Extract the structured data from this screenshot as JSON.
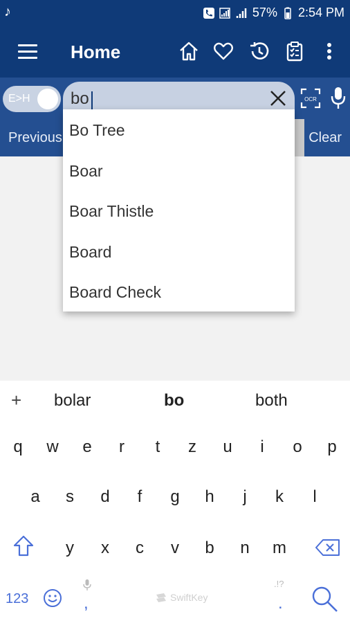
{
  "status_bar": {
    "battery": "57%",
    "time": "2:54 PM"
  },
  "app_bar": {
    "title": "Home"
  },
  "search": {
    "toggle_label": "E>H",
    "query": "bo",
    "placeholder": ""
  },
  "nav": {
    "previous_label": "Previous",
    "clear_label": "Clear"
  },
  "suggestions_dropdown": [
    "Bo Tree",
    "Boar",
    "Boar Thistle",
    "Board",
    "Board Check"
  ],
  "keyboard": {
    "predictions": [
      "bolar",
      "bo",
      "both"
    ],
    "row1": [
      "q",
      "w",
      "e",
      "r",
      "t",
      "z",
      "u",
      "i",
      "o",
      "p"
    ],
    "row2": [
      "a",
      "s",
      "d",
      "f",
      "g",
      "h",
      "j",
      "k",
      "l"
    ],
    "row3": [
      "y",
      "x",
      "c",
      "v",
      "b",
      "n",
      "m"
    ],
    "numbers_key": "123",
    "comma_key": ",",
    "period_key": ".",
    "punct_hint": ".!?",
    "brand": "SwiftKey"
  },
  "colors": {
    "primary": "#0f3a78",
    "secondary": "#244f91",
    "accent": "#4a6fd8"
  }
}
